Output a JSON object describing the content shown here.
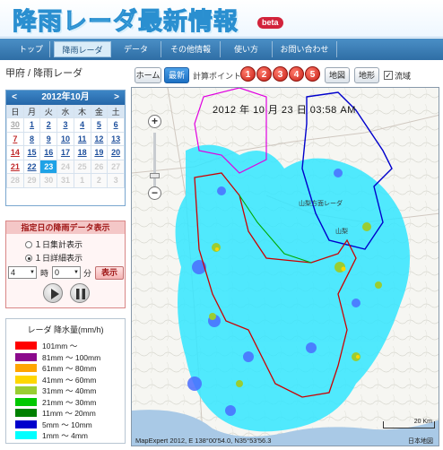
{
  "header": {
    "title": "降雨レーダ最新情報",
    "badge": "beta"
  },
  "nav": {
    "items": [
      "トップ",
      "降雨レーダ",
      "データ",
      "その他情報",
      "使い方",
      "お問い合わせ"
    ],
    "active": "降雨レーダ"
  },
  "page_title": "甲府 / 降雨レーダ",
  "toolbar": {
    "home_label": "ホーム",
    "latest_label": "最新",
    "calc_points_label": "計算ポイント:",
    "points": [
      "1",
      "2",
      "3",
      "4",
      "5"
    ],
    "map_label": "地図",
    "terrain_label": "地形",
    "basin_label": "流域",
    "basin_checked": "✓"
  },
  "calendar": {
    "title": "2012年10月",
    "prev": "<",
    "next": ">",
    "weekdays": [
      "日",
      "月",
      "火",
      "水",
      "木",
      "金",
      "土"
    ],
    "weeks": [
      [
        "30",
        "1",
        "2",
        "3",
        "4",
        "5",
        "6"
      ],
      [
        "7",
        "8",
        "9",
        "10",
        "11",
        "12",
        "13"
      ],
      [
        "14",
        "15",
        "16",
        "17",
        "18",
        "19",
        "20"
      ],
      [
        "21",
        "22",
        "23",
        "24",
        "25",
        "26",
        "27"
      ],
      [
        "28",
        "29",
        "30",
        "31",
        "1",
        "2",
        "3"
      ]
    ],
    "selected": "23"
  },
  "date_panel": {
    "title": "指定日の降雨データ表示",
    "option1": "１日集計表示",
    "option2": "１日詳細表示",
    "selected_option": "１日詳細表示",
    "hour_value": "4",
    "hour_unit": "時",
    "minute_value": "0",
    "minute_unit": "分",
    "show_button": "表示"
  },
  "legend": {
    "title": "レーダ 降水量(mm/h)",
    "items": [
      {
        "label": "101mm ～",
        "color": "#ff0000"
      },
      {
        "label": "81mm ～ 100mm",
        "color": "#8b0a8c"
      },
      {
        "label": "61mm ～ 80mm",
        "color": "#ffa500"
      },
      {
        "label": "41mm ～ 60mm",
        "color": "#ffd700"
      },
      {
        "label": "31mm ～ 40mm",
        "color": "#9acd32"
      },
      {
        "label": "21mm ～ 30mm",
        "color": "#00c800"
      },
      {
        "label": "11mm ～ 20mm",
        "color": "#008000"
      },
      {
        "label": "5mm ～ 10mm",
        "color": "#0000cc"
      },
      {
        "label": "1mm ～ 4mm",
        "color": "#00ffff"
      }
    ]
  },
  "map": {
    "timestamp": "2012 年 10 月 23 日  03:58 AM",
    "zoom_in": "+",
    "zoom_out": "−",
    "place_label_1": "山梨方面レーダ",
    "place_label_2": "山梨",
    "scale_label": "20 Km",
    "credit": "MapExpert 2012,  E 138°00'54.0, N35°53'56.3",
    "credit_right": "日本地図"
  }
}
